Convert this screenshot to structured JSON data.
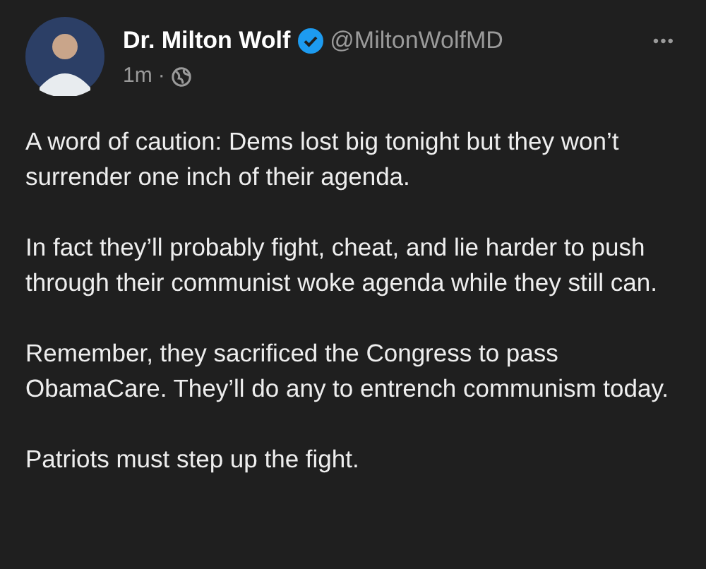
{
  "author": {
    "name": "Dr. Milton Wolf",
    "verified": true,
    "handle": "@MiltonWolfMD"
  },
  "meta": {
    "time": "1m",
    "separator": "·"
  },
  "more": "•••",
  "paragraphs": [
    "A word of caution: Dems lost big tonight but they won’t surrender one inch of their agenda.",
    "In fact they’ll probably fight, cheat, and lie harder to push through their communist woke agenda while they still can.",
    "Remember, they sacrificed the Congress to pass ObamaCare. They’ll do any to entrench communism today.",
    "Patriots must step up the fight."
  ]
}
